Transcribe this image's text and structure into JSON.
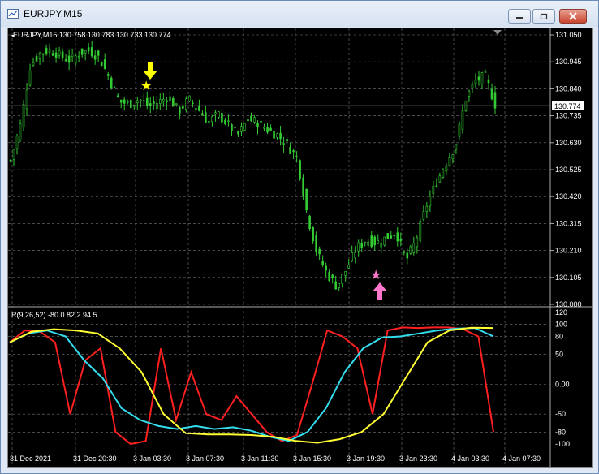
{
  "window": {
    "title": "EURJPY,M15"
  },
  "chart": {
    "header": "EURJPY,M15  130.758 130.783 130.733 130.774",
    "price_ticks": [
      "131.050",
      "130.945",
      "130.840",
      "130.735",
      "130.630",
      "130.525",
      "130.420",
      "130.315",
      "130.210",
      "130.105",
      "130.000"
    ],
    "current_price": "130.774",
    "time_ticks": [
      "31 Dec 2021",
      "31 Dec 20:30",
      "3 Jan 03:30",
      "3 Jan 07:30",
      "3 Jan 11:30",
      "3 Jan 15:30",
      "3 Jan 19:30",
      "3 Jan 23:30",
      "4 Jan 03:30",
      "4 Jan 07:30"
    ],
    "indicator_header": "R(9,26,52) -80.0 82.2 94.5",
    "indicator_ticks": [
      "120",
      "100",
      "80",
      "50",
      "0.00",
      "-50",
      "-80",
      "-100"
    ],
    "colors": {
      "candle": "#33cc33",
      "sell_arrow": "#ffff00",
      "buy_arrow": "#ff77cc",
      "red": "#ff2020",
      "cyan": "#33ddee",
      "yellow": "#ffff33",
      "grid": "#777777"
    }
  },
  "chart_data": {
    "type": "line",
    "series": [
      {
        "name": "Price",
        "values": [
          130.56,
          130.7,
          130.93,
          130.98,
          130.99,
          130.97,
          130.95,
          130.98,
          130.99,
          130.96,
          130.88,
          130.79,
          130.78,
          130.8,
          130.77,
          130.79,
          130.81,
          130.75,
          130.8,
          130.76,
          130.71,
          130.74,
          130.7,
          130.66,
          130.72,
          130.71,
          130.68,
          130.66,
          130.62,
          130.57,
          130.35,
          130.2,
          130.12,
          130.07,
          130.14,
          130.22,
          130.25,
          130.24,
          130.26,
          130.28,
          130.17,
          130.25,
          130.38,
          130.47,
          130.55,
          130.62,
          130.8,
          130.87,
          130.89,
          130.78
        ]
      },
      {
        "values": [
          70,
          90,
          88,
          70,
          -50,
          40,
          60,
          -80,
          -100,
          -95,
          60,
          -60,
          20,
          -50,
          -60,
          -20,
          -50,
          -80,
          -95,
          -85,
          0,
          90,
          80,
          60,
          -50,
          90,
          95,
          94,
          95,
          95,
          92,
          80,
          -80
        ]
      },
      {
        "values": [
          70,
          85,
          90,
          80,
          40,
          10,
          -40,
          -60,
          -70,
          -75,
          -70,
          -75,
          -72,
          -78,
          -88,
          -95,
          -80,
          -40,
          20,
          60,
          78,
          80,
          85,
          90,
          93,
          94,
          80
        ]
      },
      {
        "values": [
          70,
          88,
          92,
          90,
          85,
          60,
          20,
          -50,
          -82,
          -84,
          -84,
          -85,
          -88,
          -95,
          -98,
          -92,
          -80,
          -50,
          10,
          70,
          90,
          94.5,
          94
        ]
      }
    ]
  }
}
